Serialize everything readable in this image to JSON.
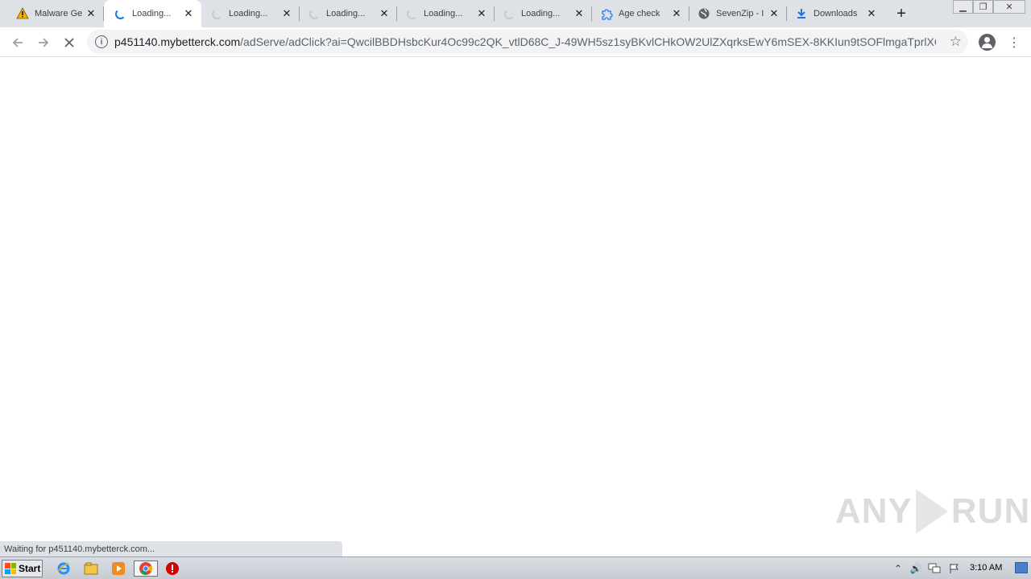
{
  "tabs": [
    {
      "title": "Malware Ge",
      "favicon": "warning-icon",
      "active": false
    },
    {
      "title": "Loading...",
      "favicon": "loading-spinner-icon",
      "active": true
    },
    {
      "title": "Loading...",
      "favicon": "loading-spinner-icon",
      "active": false
    },
    {
      "title": "Loading...",
      "favicon": "loading-spinner-icon",
      "active": false
    },
    {
      "title": "Loading...",
      "favicon": "loading-spinner-icon",
      "active": false
    },
    {
      "title": "Loading...",
      "favicon": "loading-spinner-icon",
      "active": false
    },
    {
      "title": "Age check",
      "favicon": "puzzle-icon",
      "active": false
    },
    {
      "title": "SevenZip - I",
      "favicon": "globe-icon",
      "active": false
    },
    {
      "title": "Downloads",
      "favicon": "download-icon",
      "active": false
    }
  ],
  "toolbar": {
    "url_host": "p451140.mybetterck.com",
    "url_path": "/adServe/adClick?ai=QwcilBBDHsbcKur4Oc99c2QK_vtlD68C_J-49WH5sz1syBKvlCHkOW2UlZXqrksEwY6mSEX-8KKIun9tSOFlmgaTprlXOMa..."
  },
  "status": {
    "text": "Waiting for p451140.mybetterck.com..."
  },
  "watermark": {
    "left": "ANY",
    "right": "RUN"
  },
  "taskbar": {
    "start_label": "Start",
    "clock": "3:10 AM"
  },
  "colors": {
    "tabstrip": "#dee1e6",
    "active_tab": "#ffffff",
    "omnibox": "#f1f3f4"
  }
}
